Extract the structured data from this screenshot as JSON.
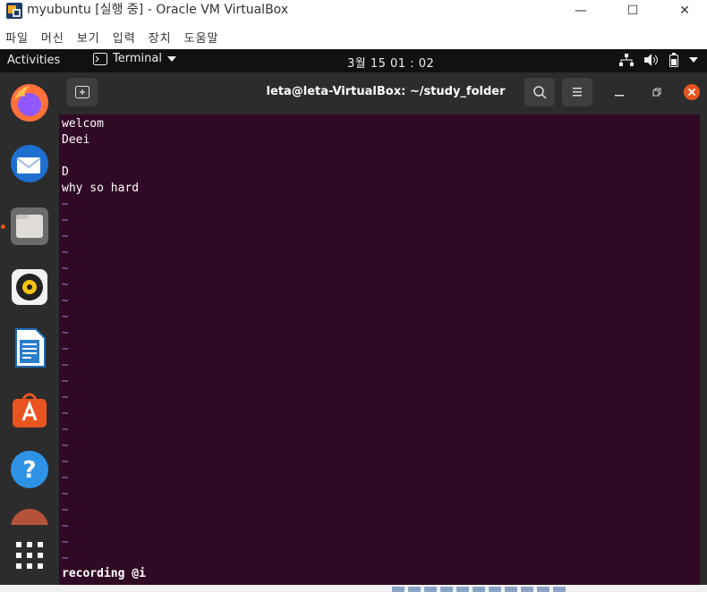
{
  "window": {
    "title": "myubuntu [실행 중] - Oracle VM VirtualBox",
    "minimize_glyph": "—",
    "maximize_glyph": "☐",
    "close_glyph": "✕"
  },
  "menubar": {
    "items": [
      "파일",
      "머신",
      "보기",
      "입력",
      "장치",
      "도움말"
    ]
  },
  "topbar": {
    "activities": "Activities",
    "app_menu": "Terminal",
    "clock": "3월 15  01 : 02"
  },
  "terminal": {
    "title": "leta@leta-VirtualBox: ~/study_folder",
    "lines": [
      "welcom",
      "Deei",
      "",
      "D",
      "why so hard"
    ],
    "tilde": "~",
    "status": "recording @i"
  },
  "colors": {
    "terminal_bg": "#300a24",
    "ubuntu_orange": "#e95420",
    "dock_bg": "#2c2c2c",
    "topbar_bg": "#111111"
  },
  "dock": {
    "icons": [
      "firefox-icon",
      "thunderbird-icon",
      "files-icon",
      "rhythmbox-icon",
      "libreoffice-writer-icon",
      "ubuntu-software-icon",
      "help-icon",
      "partial-app-icon",
      "show-applications-icon"
    ],
    "help_glyph": "?"
  }
}
